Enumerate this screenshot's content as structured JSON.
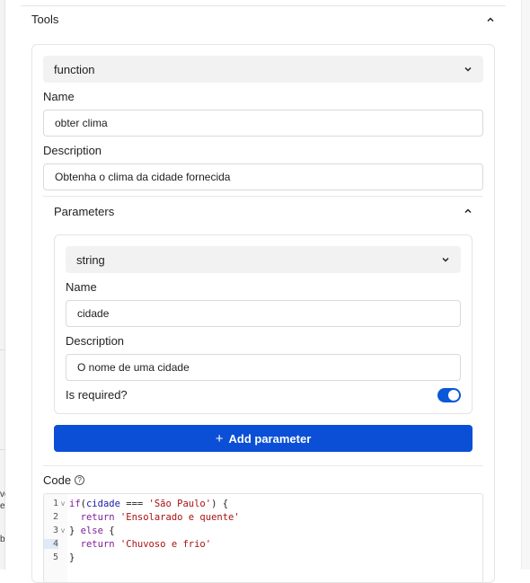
{
  "tools_section": {
    "title": "Tools"
  },
  "tool": {
    "type_select": "function",
    "name_label": "Name",
    "name_value": "obter clima",
    "description_label": "Description",
    "description_value": "Obtenha o clima da cidade fornecida",
    "parameters": {
      "title": "Parameters",
      "items": [
        {
          "type_select": "string",
          "name_label": "Name",
          "name_value": "cidade",
          "description_label": "Description",
          "description_value": "O nome de uma cidade",
          "required_label": "Is required?",
          "required": true
        }
      ],
      "add_button_label": "Add parameter",
      "add_button_icon": "+"
    },
    "code": {
      "label": "Code",
      "help_icon": "?",
      "lines": [
        {
          "n": "1",
          "fold": "v"
        },
        {
          "n": "2",
          "fold": ""
        },
        {
          "n": "3",
          "fold": "v"
        },
        {
          "n": "4",
          "fold": ""
        },
        {
          "n": "5",
          "fold": ""
        }
      ],
      "code_lines": [
        "if(cidade === 'São Paulo') {",
        "  return 'Ensolarado e quente'",
        "} else {",
        "  return 'Chuvoso e frio'",
        "}"
      ]
    }
  },
  "backdrop_fragments": [
    "ve",
    "e",
    "b"
  ],
  "colors": {
    "accent": "#0a4fd6",
    "toggle_on": "#0a58d6"
  }
}
